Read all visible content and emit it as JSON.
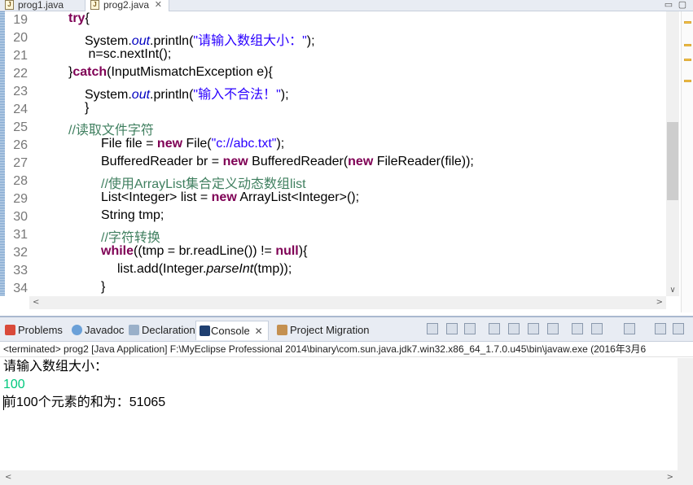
{
  "editor": {
    "tabs": [
      {
        "label": "prog1.java",
        "active": false
      },
      {
        "label": "prog2.java",
        "active": true
      }
    ],
    "close_glyph": "✕",
    "window_buttons": [
      "▭",
      "▢"
    ],
    "line_numbers": [
      "19",
      "20",
      "21",
      "22",
      "23",
      "24",
      "25",
      "26",
      "27",
      "28",
      "29",
      "30",
      "31",
      "32",
      "33",
      "34"
    ],
    "lines": [
      {
        "indent": 2,
        "tokens": [
          {
            "t": "kw",
            "v": "try"
          },
          {
            "t": "tx",
            "v": "{"
          }
        ]
      },
      {
        "indent": 3,
        "tokens": [
          {
            "t": "tx",
            "v": "System."
          },
          {
            "t": "it",
            "v": "out"
          },
          {
            "t": "tx",
            "v": ".println("
          },
          {
            "t": "st",
            "v": "\"请输入数组大小：\""
          },
          {
            "t": "tx",
            "v": ");"
          }
        ]
      },
      {
        "indent": 3,
        "tokens": [
          {
            "t": "tx",
            "v": " n=sc.nextInt();"
          }
        ]
      },
      {
        "indent": 2,
        "tokens": [
          {
            "t": "tx",
            "v": "}"
          },
          {
            "t": "kw",
            "v": "catch"
          },
          {
            "t": "tx",
            "v": "(InputMismatchException e){"
          }
        ]
      },
      {
        "indent": 3,
        "tokens": [
          {
            "t": "tx",
            "v": "System."
          },
          {
            "t": "it",
            "v": "out"
          },
          {
            "t": "tx",
            "v": ".println("
          },
          {
            "t": "st",
            "v": "\"输入不合法！\""
          },
          {
            "t": "tx",
            "v": ");"
          }
        ]
      },
      {
        "indent": 3,
        "tokens": [
          {
            "t": "tx",
            "v": "}"
          }
        ]
      },
      {
        "indent": 2,
        "tokens": [
          {
            "t": "cm",
            "v": "//读取文件字符"
          }
        ]
      },
      {
        "indent": 4,
        "tokens": [
          {
            "t": "tx",
            "v": "File file = "
          },
          {
            "t": "kw",
            "v": "new"
          },
          {
            "t": "tx",
            "v": " File("
          },
          {
            "t": "st",
            "v": "\"c://abc.txt\""
          },
          {
            "t": "tx",
            "v": ");"
          }
        ]
      },
      {
        "indent": 4,
        "tokens": [
          {
            "t": "tx",
            "v": "BufferedReader br = "
          },
          {
            "t": "kw",
            "v": "new"
          },
          {
            "t": "tx",
            "v": " BufferedReader("
          },
          {
            "t": "kw",
            "v": "new"
          },
          {
            "t": "tx",
            "v": " FileReader(file));"
          }
        ]
      },
      {
        "indent": 4,
        "tokens": [
          {
            "t": "cm",
            "v": "//使用ArrayList集合定义动态数组list"
          }
        ]
      },
      {
        "indent": 4,
        "tokens": [
          {
            "t": "tx",
            "v": "List<Integer> list = "
          },
          {
            "t": "kw",
            "v": "new"
          },
          {
            "t": "tx",
            "v": " ArrayList<Integer>();"
          }
        ]
      },
      {
        "indent": 4,
        "tokens": [
          {
            "t": "tx",
            "v": "String tmp;"
          }
        ]
      },
      {
        "indent": 4,
        "tokens": [
          {
            "t": "cm",
            "v": "//字符转换"
          }
        ]
      },
      {
        "indent": 4,
        "tokens": [
          {
            "t": "kw",
            "v": "while"
          },
          {
            "t": "tx",
            "v": "((tmp = br.readLine()) != "
          },
          {
            "t": "kw",
            "v": "null"
          },
          {
            "t": "tx",
            "v": "){"
          }
        ]
      },
      {
        "indent": 5,
        "tokens": [
          {
            "t": "tx",
            "v": "list.add(Integer."
          },
          {
            "t": "im",
            "v": "parseInt"
          },
          {
            "t": "tx",
            "v": "(tmp));"
          }
        ]
      },
      {
        "indent": 4,
        "tokens": [
          {
            "t": "tx",
            "v": "}"
          }
        ]
      }
    ]
  },
  "views": {
    "tabs": {
      "problems": "Problems",
      "javadoc": "Javadoc",
      "declaration": "Declaration",
      "console": "Console",
      "migration": "Project Migration"
    },
    "console_close": "✕"
  },
  "console": {
    "header": "<terminated> prog2 [Java Application] F:\\MyEclipse Professional 2014\\binary\\com.sun.java.jdk7.win32.x86_64_1.7.0.u45\\bin\\javaw.exe (2016年3月6",
    "output": [
      {
        "text": "请输入数组大小：",
        "kind": "out"
      },
      {
        "text": "100",
        "kind": "in"
      },
      {
        "text": "前100个元素的和为：51065",
        "kind": "out"
      }
    ]
  },
  "scroll_glyphs": {
    "left": "<",
    "right": ">",
    "down": "∨"
  },
  "colors": {
    "keyword": "#7f0055",
    "comment": "#3f7f5f",
    "string": "#2a00ff",
    "field": "#0000c0",
    "console_input": "#00c87d"
  }
}
